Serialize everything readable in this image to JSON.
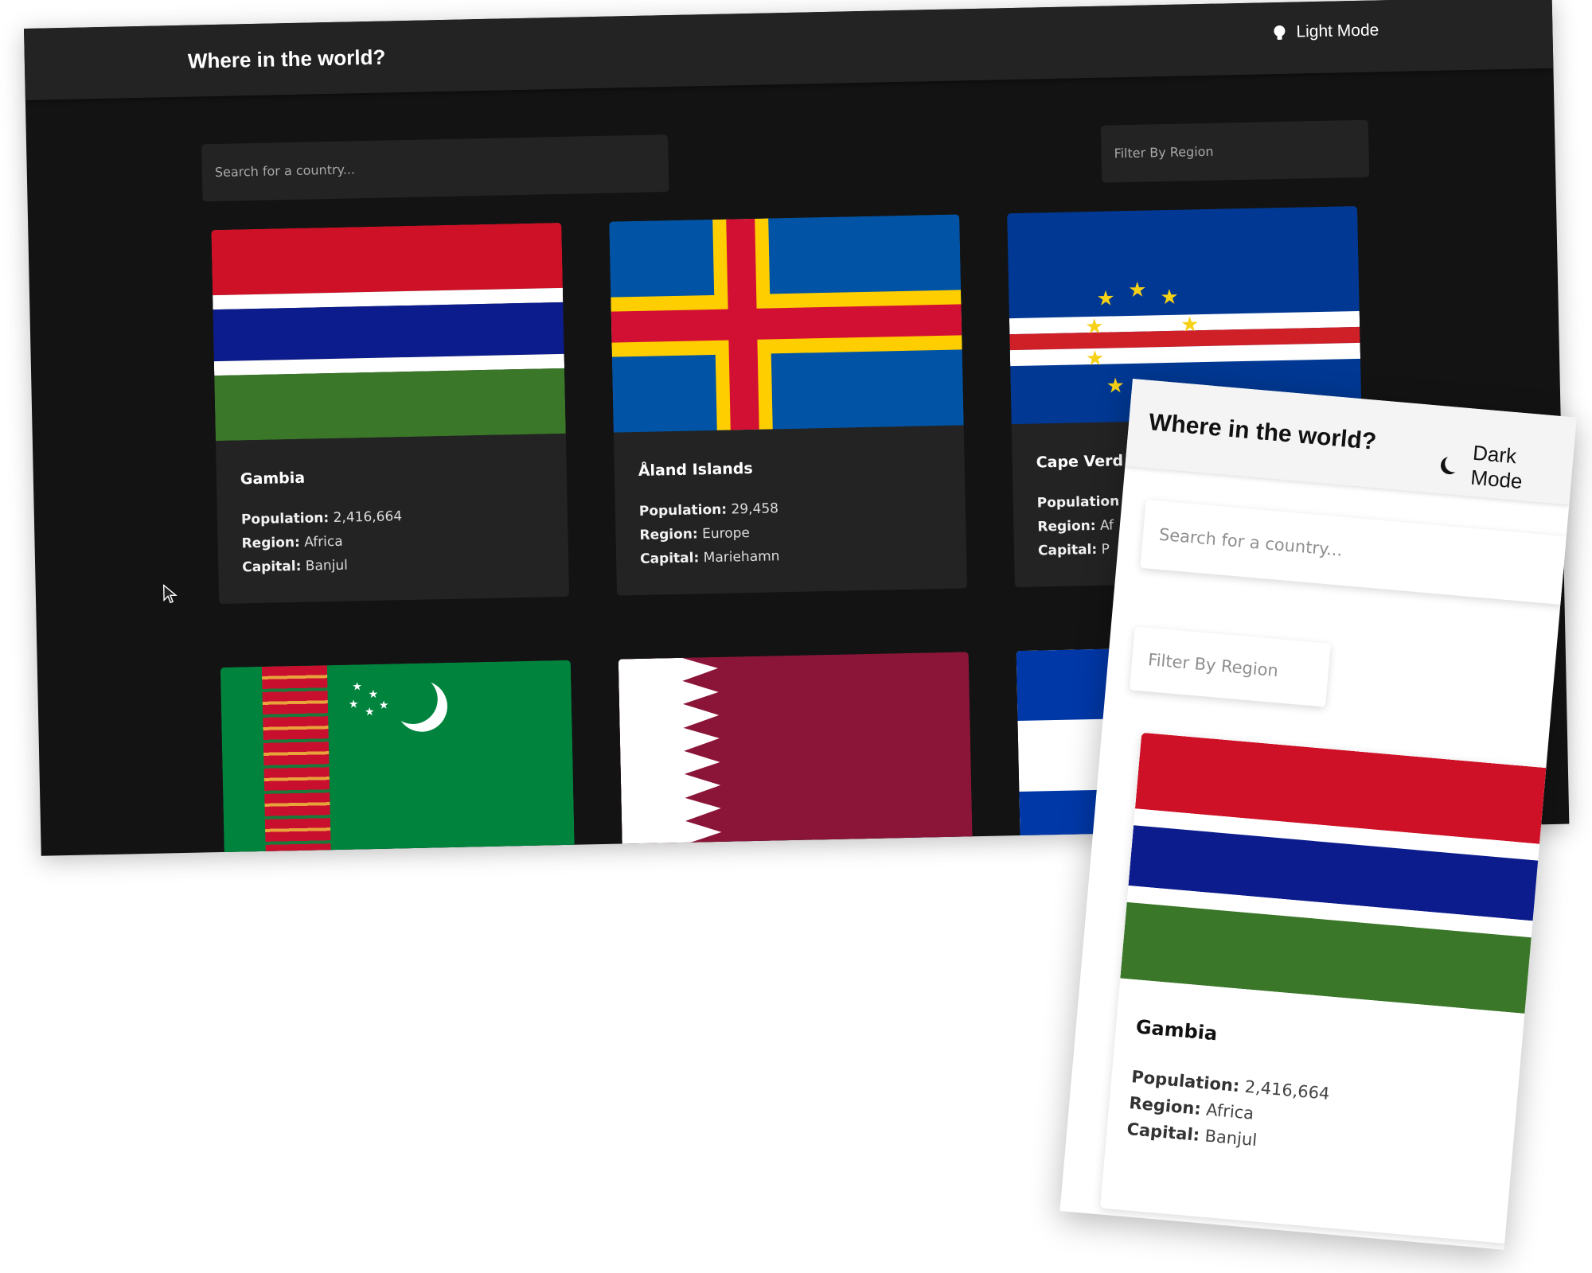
{
  "dark_app": {
    "title": "Where in the world?",
    "mode_toggle": "Light Mode",
    "search_placeholder": "Search for a country...",
    "filter_label": "Filter By Region",
    "cards": [
      {
        "name": "Gambia",
        "population_label": "Population:",
        "population": "2,416,664",
        "region_label": "Region:",
        "region": "Africa",
        "capital_label": "Capital:",
        "capital": "Banjul"
      },
      {
        "name": "Åland Islands",
        "population_label": "Population:",
        "population": "29,458",
        "region_label": "Region:",
        "region": "Europe",
        "capital_label": "Capital:",
        "capital": "Mariehamn"
      },
      {
        "name": "Cape Verd",
        "population_label": "Population",
        "population": "",
        "region_label": "Region:",
        "region": "Af",
        "capital_label": "Capital:",
        "capital": "P"
      }
    ],
    "flag_icons": [
      "gambia-flag",
      "aland-flag",
      "cape-verde-flag",
      "turkmenistan-flag",
      "qatar-flag",
      "partial-flag"
    ]
  },
  "light_app": {
    "title": "Where in the world?",
    "mode_toggle": "Dark Mode",
    "search_placeholder": "Search for a country...",
    "filter_label": "Filter By Region",
    "card": {
      "name": "Gambia",
      "population_label": "Population:",
      "population": "2,416,664",
      "region_label": "Region:",
      "region": "Africa",
      "capital_label": "Capital:",
      "capital": "Banjul"
    }
  },
  "colors": {
    "dark_bg": "#131313",
    "dark_element": "#232323",
    "light_header": "#f4f4f4",
    "gambia_red": "#ce1126",
    "gambia_blue": "#0c1c8c",
    "gambia_green": "#3a7728",
    "aland_blue": "#0053a5",
    "aland_yellow": "#ffce00",
    "aland_red": "#d21034",
    "qatar_maroon": "#8a1538",
    "turkmen_green": "#00843d"
  }
}
